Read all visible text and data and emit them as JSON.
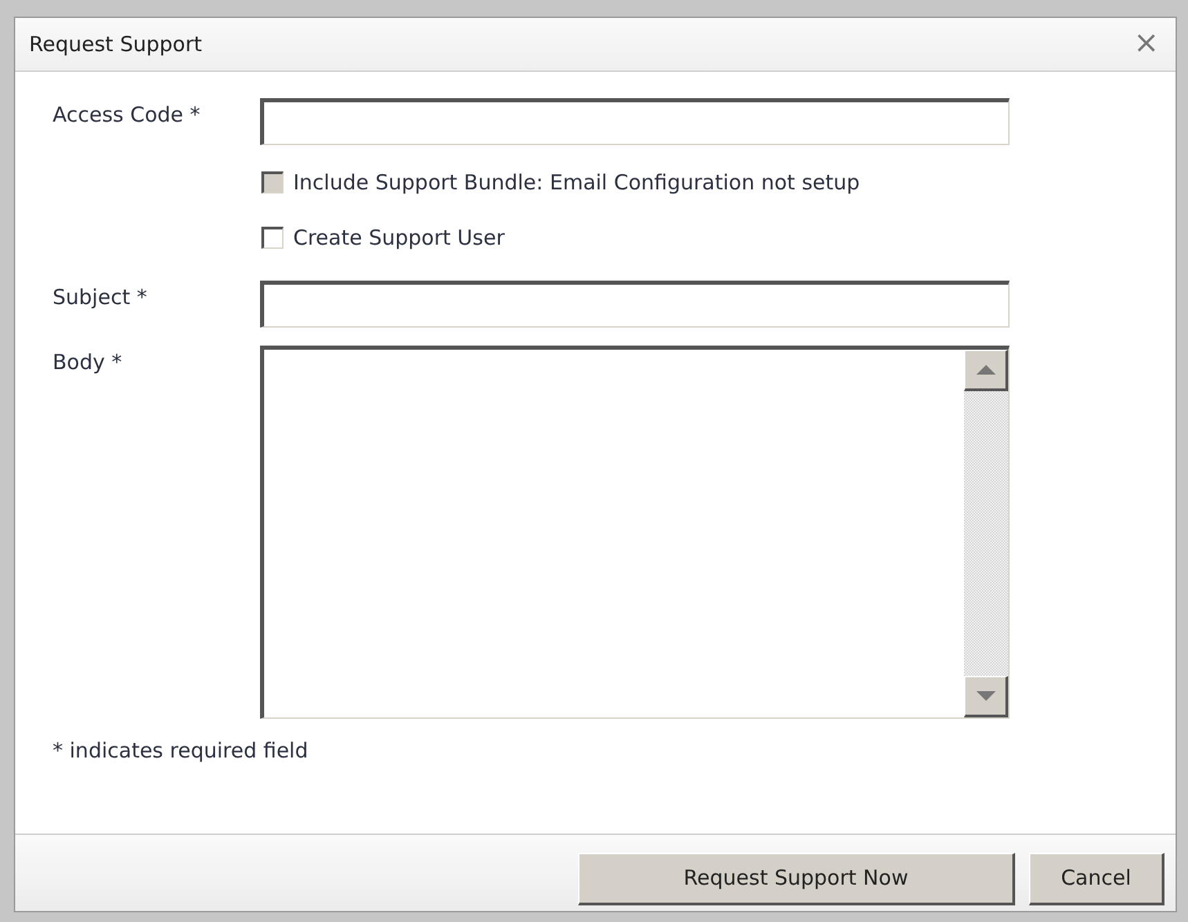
{
  "dialog": {
    "title": "Request Support",
    "close": "×"
  },
  "fields": [
    {
      "kind": "text",
      "label": "Access Code *"
    },
    {
      "kind": "checkbox",
      "label": "Include Support Bundle: Email Configuration not setup",
      "checked": false,
      "disabled": true
    },
    {
      "kind": "checkbox",
      "label": "Create Support User",
      "checked": false,
      "disabled": false
    },
    {
      "kind": "text",
      "label": "Subject *"
    },
    {
      "kind": "textarea",
      "label": "Body *"
    }
  ],
  "note": "* indicates required field",
  "buttons": [
    "Request Support Now",
    "Cancel"
  ]
}
